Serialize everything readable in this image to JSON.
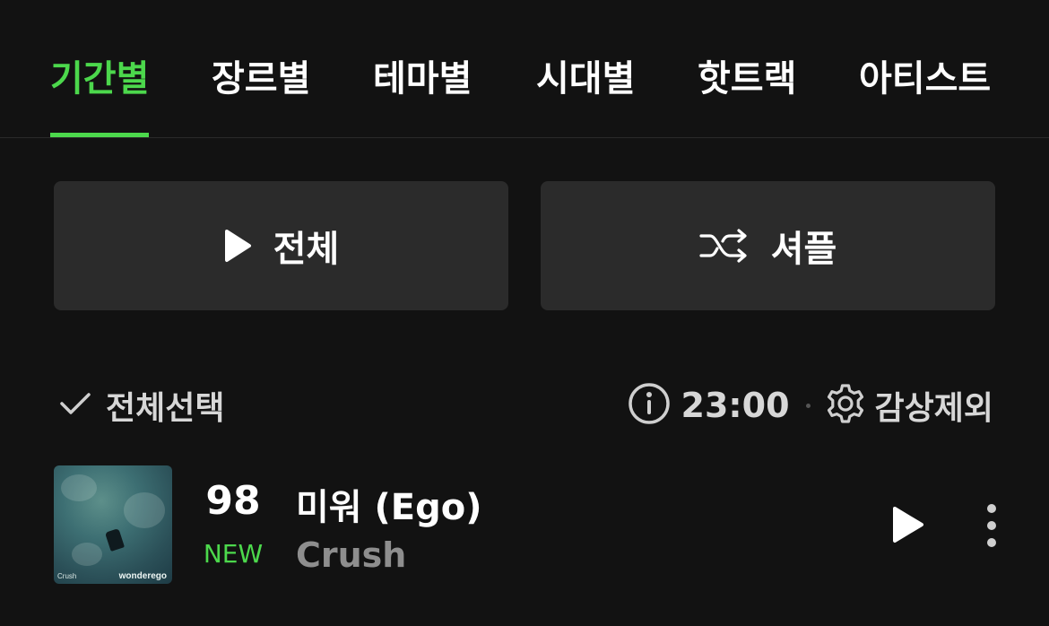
{
  "tabs": [
    {
      "label": "기간별",
      "active": true
    },
    {
      "label": "장르별",
      "active": false
    },
    {
      "label": "테마별",
      "active": false
    },
    {
      "label": "시대별",
      "active": false
    },
    {
      "label": "핫트랙",
      "active": false
    },
    {
      "label": "아티스트",
      "active": false
    }
  ],
  "actions": {
    "play_all_label": "전체",
    "shuffle_label": "셔플"
  },
  "list_header": {
    "select_all_label": "전체선택",
    "update_time": "23:00",
    "exclude_label": "감상제외"
  },
  "songs": [
    {
      "rank": "98",
      "rank_change": "NEW",
      "title": "미워 (Ego)",
      "artist": "Crush",
      "album_art_artist": "Crush",
      "album_art_title": "wonderego"
    }
  ],
  "colors": {
    "background": "#121212",
    "accent": "#4cd84c",
    "button_bg": "#2b2b2b",
    "secondary_text": "#8e8e8e"
  },
  "icons": {
    "play_all": "play-icon",
    "shuffle": "shuffle-icon",
    "select_all": "check-icon",
    "info": "info-icon",
    "exclude": "gear-icon",
    "row_play": "play-icon",
    "row_more": "more-vertical-icon"
  }
}
